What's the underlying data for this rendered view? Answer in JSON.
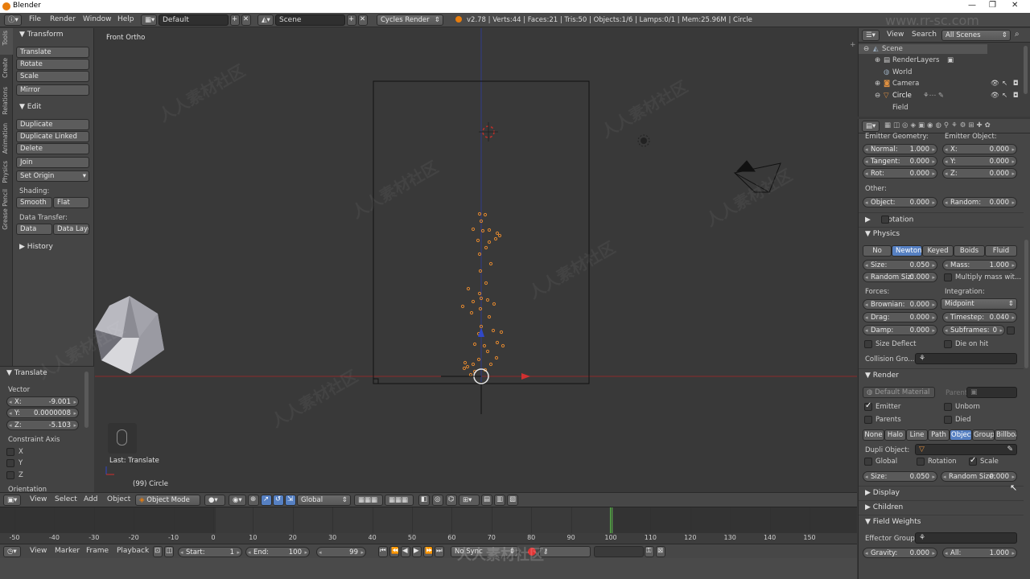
{
  "window": {
    "title": "Blender"
  },
  "menu": {
    "file": "File",
    "render": "Render",
    "window": "Window",
    "help": "Help"
  },
  "header": {
    "layout": "Default",
    "scene": "Scene",
    "engine": "Cycles Render",
    "stats": "v2.78 | Verts:44 | Faces:21 | Tris:50 | Objects:1/6 | Lamps:0/1 | Mem:25.96M | Circle"
  },
  "toolshelf": {
    "tabs": [
      "Tools",
      "Create",
      "Relations",
      "Animation",
      "Physics",
      "Grease Pencil"
    ],
    "transform": {
      "title": "Transform",
      "translate": "Translate",
      "rotate": "Rotate",
      "scale": "Scale",
      "mirror": "Mirror"
    },
    "edit": {
      "title": "Edit",
      "duplicate": "Duplicate",
      "duplicate_linked": "Duplicate Linked",
      "delete": "Delete",
      "join": "Join",
      "set_origin": "Set Origin",
      "shading_label": "Shading:",
      "smooth": "Smooth",
      "flat": "Flat",
      "data_transfer_label": "Data Transfer:",
      "data": "Data",
      "data_layo": "Data Layo"
    },
    "history": "History"
  },
  "operator": {
    "title": "Translate",
    "vector_label": "Vector",
    "x_label": "X:",
    "x": "-9.001",
    "y_label": "Y:",
    "y": "0.0000008",
    "z_label": "Z:",
    "z": "-5.103",
    "constraint_label": "Constraint Axis",
    "cx": "X",
    "cy": "Y",
    "cz": "Z",
    "orientation": "Orientation"
  },
  "viewport": {
    "view_name": "Front Ortho",
    "last_op": "Last: Translate",
    "object_info": "(99) Circle"
  },
  "viewheader": {
    "view": "View",
    "select": "Select",
    "add": "Add",
    "object": "Object",
    "mode": "Object Mode",
    "orientation": "Global"
  },
  "timeline": {
    "ticks": [
      "-50",
      "-40",
      "-30",
      "-20",
      "-10",
      "0",
      "10",
      "20",
      "30",
      "40",
      "50",
      "60",
      "70",
      "80",
      "90",
      "100",
      "110",
      "120",
      "130",
      "140",
      "150"
    ]
  },
  "timeheader": {
    "view": "View",
    "marker": "Marker",
    "frame": "Frame",
    "playback": "Playback",
    "start_label": "Start:",
    "start": "1",
    "end_label": "End:",
    "end": "100",
    "current": "99",
    "sync": "No Sync"
  },
  "outliner": {
    "view": "View",
    "search": "Search",
    "filter": "All Scenes",
    "items": [
      "Scene",
      "RenderLayers",
      "World",
      "Camera",
      "Circle",
      "Field"
    ]
  },
  "props": {
    "emitter_geometry": "Emitter Geometry:",
    "emitter_object": "Emitter Object:",
    "normal_label": "Normal:",
    "normal": "1.000",
    "tangent_label": "Tangent:",
    "tangent": "0.000",
    "rot_label": "Rot:",
    "rot": "0.000",
    "ex_label": "X:",
    "ex": "0.000",
    "ey_label": "Y:",
    "ey": "0.000",
    "ez_label": "Z:",
    "ez": "0.000",
    "other": "Other:",
    "object_label": "Object:",
    "object": "0.000",
    "random_label": "Random:",
    "random": "0.000",
    "rotation": "Rotation",
    "physics": "Physics",
    "phys_types": [
      "No",
      "Newtonia",
      "Keyed",
      "Boids",
      "Fluid"
    ],
    "size_label": "Size:",
    "size": "0.050",
    "mass_label": "Mass:",
    "mass": "1.000",
    "random_size_label": "Random Siz:",
    "random_size": "0.000",
    "multiply_mass": "Multiply mass wit...",
    "forces": "Forces:",
    "integration": "Integration:",
    "brownian_label": "Brownian:",
    "brownian": "0.000",
    "integrator": "Midpoint",
    "drag_label": "Drag:",
    "drag": "0.000",
    "timestep_label": "Timestep:",
    "timestep": "0.040",
    "damp_label": "Damp:",
    "damp": "0.000",
    "subframes_label": "Subframes:",
    "subframes": "0",
    "size_deflect": "Size Deflect",
    "die_on_hit": "Die on hit",
    "collision_group": "Collision Gro...",
    "render": "Render",
    "default_material": "Default Material",
    "parent": "Parent",
    "emitter": "Emitter",
    "unborn": "Unborn",
    "parents": "Parents",
    "died": "Died",
    "render_types": [
      "None",
      "Halo",
      "Line",
      "Path",
      "Object",
      "Group",
      "Billboa"
    ],
    "dupli_object": "Dupli Object:",
    "global": "Global",
    "rotation2": "Rotation",
    "scale": "Scale",
    "rsize_label": "Size:",
    "rsize": "0.050",
    "rrandom_label": "Random Size:",
    "rrandom": "0.000",
    "display": "Display",
    "children": "Children",
    "field_weights": "Field Weights",
    "effector_group": "Effector Group:",
    "gravity_label": "Gravity:",
    "gravity": "0.000",
    "all_label": "All:",
    "all": "1.000"
  },
  "watermark": {
    "text": "人人素材社区",
    "url": "www.rr-sc.com"
  }
}
